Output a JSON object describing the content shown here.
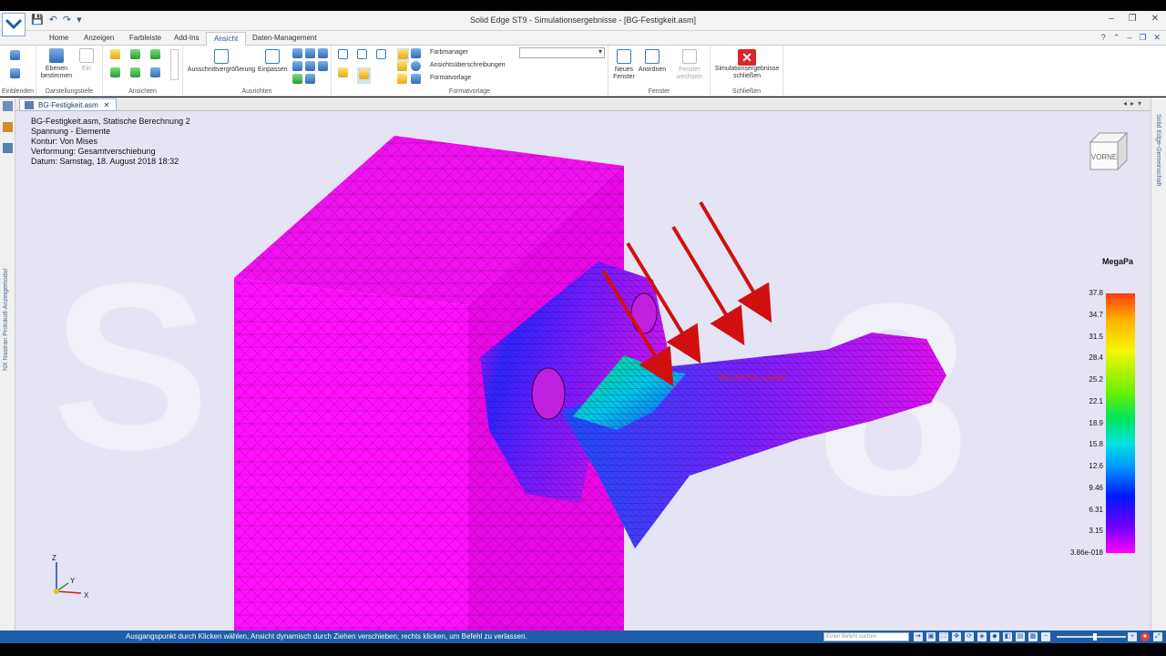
{
  "window": {
    "title": "Solid Edge ST9 - Simulationsergebnisse - [BG-Festigkeit.asm]"
  },
  "ribbon_tabs": [
    "Home",
    "Anzeigen",
    "Farbleiste",
    "Add-Ins",
    "Ansicht",
    "Daten-Management"
  ],
  "active_tab": "Ansicht",
  "ribbon": {
    "einblenden_label": "Einblenden",
    "ebenen_button": "Ebenen bestimmen",
    "ein_button": "Ein",
    "darstellungstiefe_label": "Darstellungstiefe",
    "ansichten_label": "Ansichten",
    "ausschnitt_button": "Ausschnittvergrößerung",
    "einpassen_button": "Einpassen",
    "ausrichten_label": "Ausrichten",
    "farbmanager": "Farbmanager",
    "ansichtsueberschreibungen": "Ansichtsüberschreibungen",
    "formatvorlage_item": "Formatvorlage",
    "formatvorlage_label": "Formatvorlage",
    "neues_fenster": "Neues Fenster",
    "anordnen": "Anordnen",
    "fenster_wechseln": "Fenster wechseln",
    "fenster_label": "Fenster",
    "sim_close_button": "Simulationsergebnisse schließen",
    "schliessen_label": "Schließen"
  },
  "left_panel_title": "NX Nastran Protokoll-Anzeigemodul",
  "right_panel_title": "Solid Edge-Gemeinschaft",
  "doc_tab": {
    "label": "BG-Festigkeit.asm",
    "close": "✕"
  },
  "info": {
    "line1": "BG-Festigkeit.asm, Statische Berechnung 2",
    "line2": "Spannung - Elemente",
    "line3": "Kontur: Von Mises",
    "line4": "Verformung: Gesamtverschiebung",
    "line5": "Datum: Samstag, 18. August 2018  18:32"
  },
  "nav_cube_label": "VORNE",
  "load_label": "850,000 Nm, Lastfall",
  "legend": {
    "unit": "MegaPa",
    "values": [
      "37.8",
      "34.7",
      "31.5",
      "28.4",
      "25.2",
      "22.1",
      "18.9",
      "15.8",
      "12.6",
      "9.46",
      "6.31",
      "3.15",
      "3.86e-018"
    ]
  },
  "axes": {
    "z": "Z",
    "y": "Y",
    "x": "X"
  },
  "status": {
    "text": "Ausgangspunkt durch Klicken wählen, Ansicht dynamisch durch Ziehen verschieben; rechts klicken, um Befehl zu verlassen.",
    "command_placeholder": "Einen Befehl suchen"
  },
  "colors": {
    "accent": "#1f5ea8",
    "mesh_magenta": "#ff00ff",
    "force_arrow": "#d01010",
    "viewport_bg": "#e4e4f4"
  }
}
